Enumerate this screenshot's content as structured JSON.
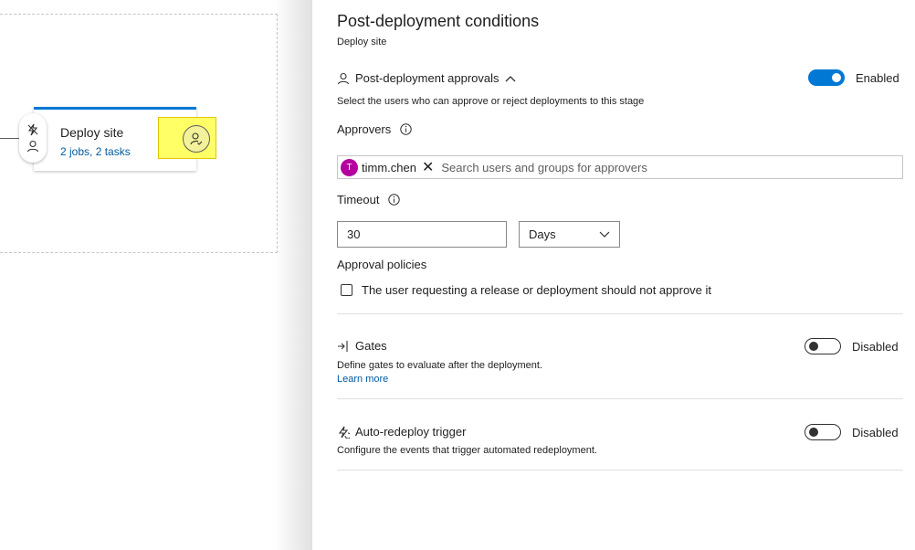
{
  "pipeline": {
    "stage_name": "Deploy site",
    "stage_summary": "2 jobs, 2 tasks"
  },
  "panel": {
    "title": "Post-deployment conditions",
    "subtitle": "Deploy site",
    "approvals": {
      "heading": "Post-deployment approvals",
      "toggle_label": "Enabled",
      "description": "Select the users who can approve or reject deployments to this stage",
      "approvers_label": "Approvers",
      "approver": {
        "initial": "T",
        "name": "timm.chen",
        "remove": "✕"
      },
      "search_placeholder": "Search users and groups for approvers",
      "timeout_label": "Timeout",
      "timeout_value": "30",
      "timeout_unit": "Days",
      "policies_label": "Approval policies",
      "policy_option": "The user requesting a release or deployment should not approve it"
    },
    "gates": {
      "heading": "Gates",
      "toggle_label": "Disabled",
      "description": "Define gates to evaluate after the deployment.",
      "learn_more": "Learn more"
    },
    "redeploy": {
      "heading": "Auto-redeploy trigger",
      "toggle_label": "Disabled",
      "description": "Configure the events that trigger automated redeployment."
    }
  },
  "colors": {
    "accent": "#0078d4",
    "highlight": "#ffff66",
    "avatar": "#b4009e"
  }
}
